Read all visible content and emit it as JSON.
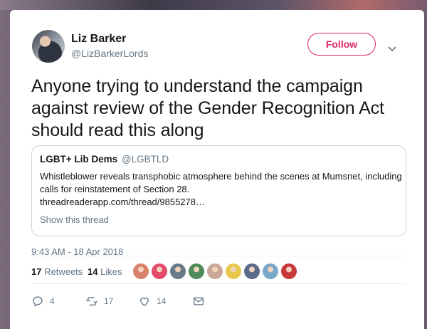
{
  "author": {
    "name": "Liz Barker",
    "handle": "@LizBarkerLords"
  },
  "follow_label": "Follow",
  "tweet_text": "Anyone trying to understand the campaign against review of the Gender Recognition Act should read this along",
  "quoted": {
    "name": "LGBT+ Lib Dems",
    "handle": "@LGBTLD",
    "text": "Whistleblower reveals transphobic atmosphere behind the scenes at Mumsnet, including calls for reinstatement of Section 28.",
    "link": "threadreaderapp.com/thread/9855278…",
    "show_thread": "Show this thread"
  },
  "timestamp": "9:43 AM - 18 Apr 2018",
  "stats": {
    "retweets_count": "17",
    "retweets_label": "Retweets",
    "likes_count": "14",
    "likes_label": "Likes"
  },
  "liker_colors": [
    "#d9826a",
    "#e34b6a",
    "#6a7a88",
    "#4e8a5a",
    "#c9a89a",
    "#e8c84a",
    "#5a6a8a",
    "#7aa8c8",
    "#c83a3a"
  ],
  "actions": {
    "reply_count": "4",
    "retweet_count": "17",
    "like_count": "14"
  },
  "icons": [
    "chevron-down-icon",
    "reply-icon",
    "retweet-icon",
    "heart-icon",
    "envelope-icon"
  ],
  "colors": {
    "accent": "#e0245e",
    "muted": "#657786",
    "text": "#14171a"
  }
}
